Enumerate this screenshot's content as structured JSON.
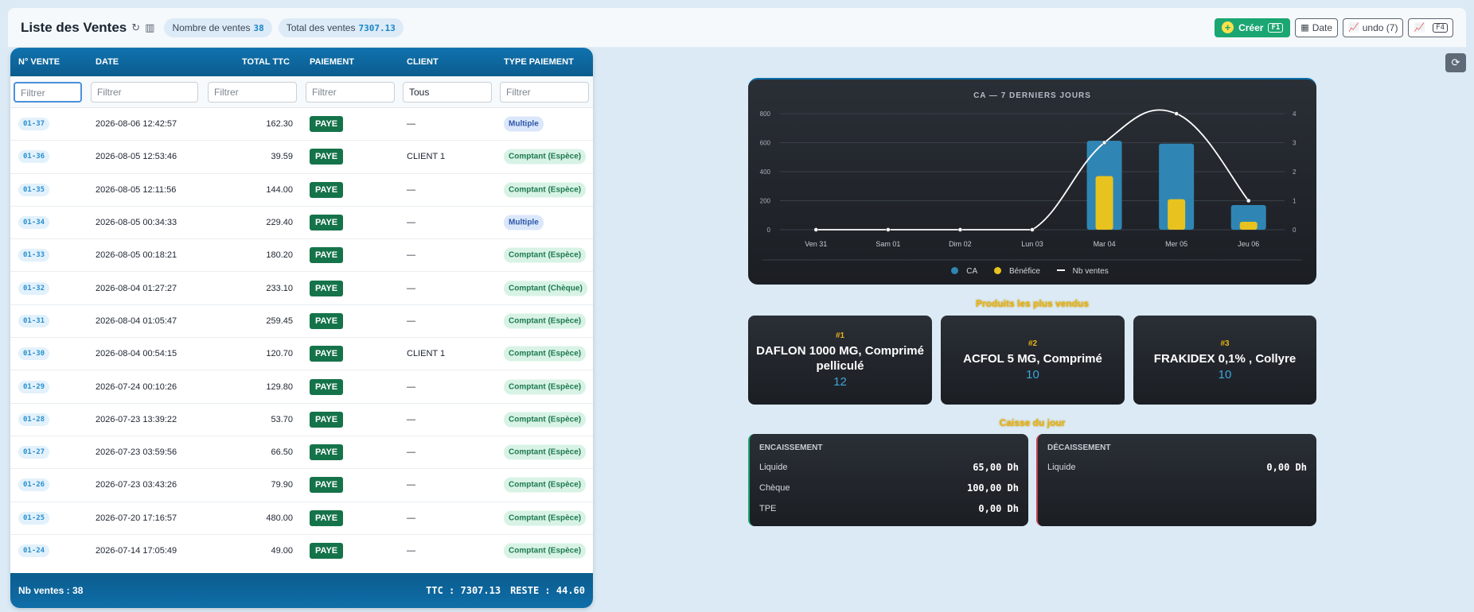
{
  "header": {
    "title": "Liste des Ventes",
    "nb_label": "Nombre de ventes",
    "nb_value": "38",
    "total_label": "Total des ventes",
    "total_value": "7307.13",
    "create_label": "Créer",
    "create_kbd": "F1",
    "date_label": "Date",
    "undo_label": "undo (7)",
    "chart_kbd": "F4"
  },
  "table": {
    "columns": [
      "N° VENTE",
      "DATE",
      "TOTAL TTC",
      "PAIEMENT",
      "CLIENT",
      "TYPE PAIEMENT"
    ],
    "filters": [
      "Filtrer",
      "Filtrer",
      "Filtrer",
      "Filtrer",
      "Tous",
      "Filtrer"
    ],
    "rows": [
      {
        "num": "01-37",
        "date": "2026-08-06 12:42:57",
        "total": "162.30",
        "pay": "PAYE",
        "client": "—",
        "type": "Multiple"
      },
      {
        "num": "01-36",
        "date": "2026-08-05 12:53:46",
        "total": "39.59",
        "pay": "PAYE",
        "client": "CLIENT 1",
        "type": "Comptant (Espèce)"
      },
      {
        "num": "01-35",
        "date": "2026-08-05 12:11:56",
        "total": "144.00",
        "pay": "PAYE",
        "client": "—",
        "type": "Comptant (Espèce)"
      },
      {
        "num": "01-34",
        "date": "2026-08-05 00:34:33",
        "total": "229.40",
        "pay": "PAYE",
        "client": "—",
        "type": "Multiple"
      },
      {
        "num": "01-33",
        "date": "2026-08-05 00:18:21",
        "total": "180.20",
        "pay": "PAYE",
        "client": "—",
        "type": "Comptant (Espèce)"
      },
      {
        "num": "01-32",
        "date": "2026-08-04 01:27:27",
        "total": "233.10",
        "pay": "PAYE",
        "client": "—",
        "type": "Comptant (Chèque)"
      },
      {
        "num": "01-31",
        "date": "2026-08-04 01:05:47",
        "total": "259.45",
        "pay": "PAYE",
        "client": "—",
        "type": "Comptant (Espèce)"
      },
      {
        "num": "01-30",
        "date": "2026-08-04 00:54:15",
        "total": "120.70",
        "pay": "PAYE",
        "client": "CLIENT 1",
        "type": "Comptant (Espèce)"
      },
      {
        "num": "01-29",
        "date": "2026-07-24 00:10:26",
        "total": "129.80",
        "pay": "PAYE",
        "client": "—",
        "type": "Comptant (Espèce)"
      },
      {
        "num": "01-28",
        "date": "2026-07-23 13:39:22",
        "total": "53.70",
        "pay": "PAYE",
        "client": "—",
        "type": "Comptant (Espèce)"
      },
      {
        "num": "01-27",
        "date": "2026-07-23 03:59:56",
        "total": "66.50",
        "pay": "PAYE",
        "client": "—",
        "type": "Comptant (Espèce)"
      },
      {
        "num": "01-26",
        "date": "2026-07-23 03:43:26",
        "total": "79.90",
        "pay": "PAYE",
        "client": "—",
        "type": "Comptant (Espèce)"
      },
      {
        "num": "01-25",
        "date": "2026-07-20 17:16:57",
        "total": "480.00",
        "pay": "PAYE",
        "client": "—",
        "type": "Comptant (Espèce)"
      },
      {
        "num": "01-24",
        "date": "2026-07-14 17:05:49",
        "total": "49.00",
        "pay": "PAYE",
        "client": "—",
        "type": "Comptant (Espèce)"
      }
    ],
    "footer_count": "Nb ventes : 38",
    "footer_ttc": "TTC : 7307.13",
    "footer_reste": "RESTE : 44.60"
  },
  "chart_data": {
    "type": "bar",
    "title": "CA — 7 DERNIERS JOURS",
    "categories": [
      "Ven 31",
      "Sam 01",
      "Dim 02",
      "Lun 03",
      "Mar 04",
      "Mer 05",
      "Jeu 06"
    ],
    "series": [
      {
        "name": "CA",
        "type": "bar",
        "axis": "left",
        "color": "#2f86b4",
        "values": [
          0,
          0,
          0,
          0,
          613,
          593,
          170
        ]
      },
      {
        "name": "Bénéfice",
        "type": "bar",
        "axis": "left",
        "color": "#e8c21e",
        "values": [
          0,
          0,
          0,
          0,
          370,
          210,
          55
        ]
      },
      {
        "name": "Nb ventes",
        "type": "line",
        "axis": "right",
        "color": "#ffffff",
        "values": [
          0,
          0,
          0,
          0,
          3,
          4,
          1
        ]
      }
    ],
    "ylim_left": [
      0,
      800
    ],
    "yticks_left": [
      0,
      200,
      400,
      600,
      800
    ],
    "ylim_right": [
      0,
      4
    ],
    "yticks_right": [
      0,
      1,
      2,
      3,
      4
    ],
    "legend_position": "bottom",
    "grid": true
  },
  "top_products": {
    "title": "Produits les plus vendus",
    "items": [
      {
        "rank": "#1",
        "name": "DAFLON 1000 MG, Comprimé pelliculé",
        "qty": "12"
      },
      {
        "rank": "#2",
        "name": "ACFOL 5 MG, Comprimé",
        "qty": "10"
      },
      {
        "rank": "#3",
        "name": "FRAKIDEX 0,1% , Collyre",
        "qty": "10"
      }
    ]
  },
  "cash": {
    "title": "Caisse du jour",
    "encaissement": {
      "label": "ENCAISSEMENT",
      "lines": [
        {
          "label": "Liquide",
          "value": "65,00 Dh"
        },
        {
          "label": "Chèque",
          "value": "100,00 Dh"
        },
        {
          "label": "TPE",
          "value": "0,00 Dh"
        }
      ]
    },
    "decaissement": {
      "label": "DÉCAISSEMENT",
      "lines": [
        {
          "label": "Liquide",
          "value": "0,00 Dh"
        }
      ]
    }
  }
}
